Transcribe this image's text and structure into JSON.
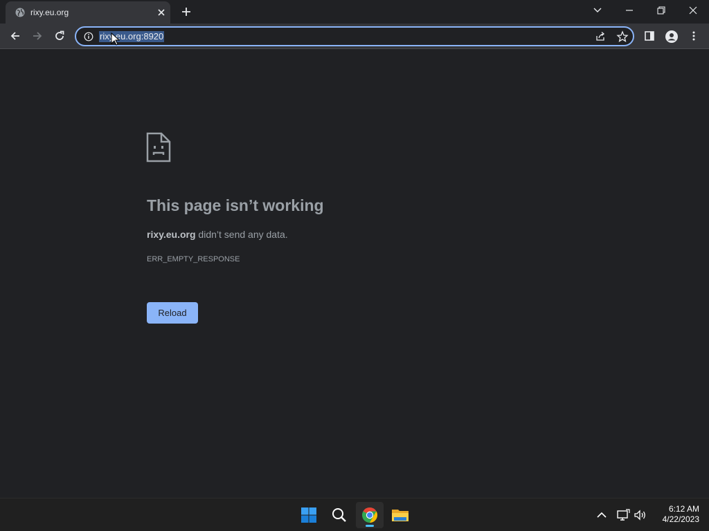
{
  "tab": {
    "title": "rixy.eu.org",
    "favicon": "globe-icon"
  },
  "toolbar": {
    "url": "rixy.eu.org:8920",
    "omnibox_focus_color": "#8ab4f8"
  },
  "error": {
    "icon": "sad-document-icon",
    "title": "This page isn’t working",
    "host": "rixy.eu.org",
    "message_suffix": " didn’t send any data.",
    "code": "ERR_EMPTY_RESPONSE",
    "reload_label": "Reload",
    "button_color": "#8ab4f8"
  },
  "taskbar": {
    "apps": [
      "start-icon",
      "search-icon",
      "chrome-icon",
      "file-explorer-icon"
    ],
    "active_app": "chrome-icon",
    "time": "6:12 AM",
    "date": "4/22/2023"
  },
  "theme": {
    "background": "#202124",
    "toolbar": "#35363a"
  }
}
